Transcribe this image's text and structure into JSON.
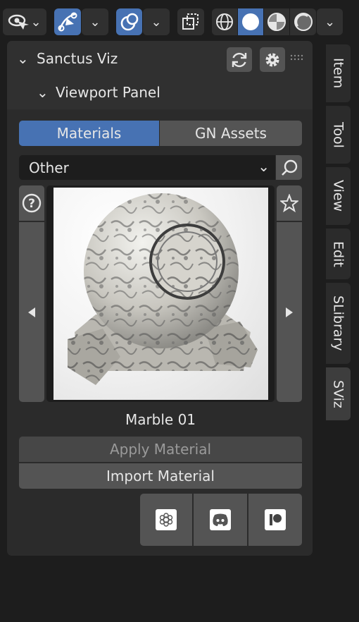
{
  "header": {
    "icons": [
      "visibility-eye-icon",
      "gizmo-icon",
      "overlay-icon",
      "xray-icon",
      "wireframe-shading-icon",
      "solid-shading-icon",
      "material-shading-icon",
      "rendered-shading-icon"
    ]
  },
  "panel": {
    "title": "Sanctus Viz",
    "subpanel_title": "Viewport Panel",
    "tabs": [
      {
        "label": "Materials",
        "active": true
      },
      {
        "label": "GN Assets",
        "active": false
      }
    ],
    "category": "Other",
    "preview_name": "Marble 01",
    "apply_label": "Apply Material",
    "import_label": "Import Material"
  },
  "sidebar_tabs": [
    "Item",
    "Tool",
    "View",
    "Edit",
    "SLibrary",
    "SViz"
  ],
  "colors": {
    "accent": "#4772b3",
    "panel": "#303030",
    "button": "#545454"
  }
}
